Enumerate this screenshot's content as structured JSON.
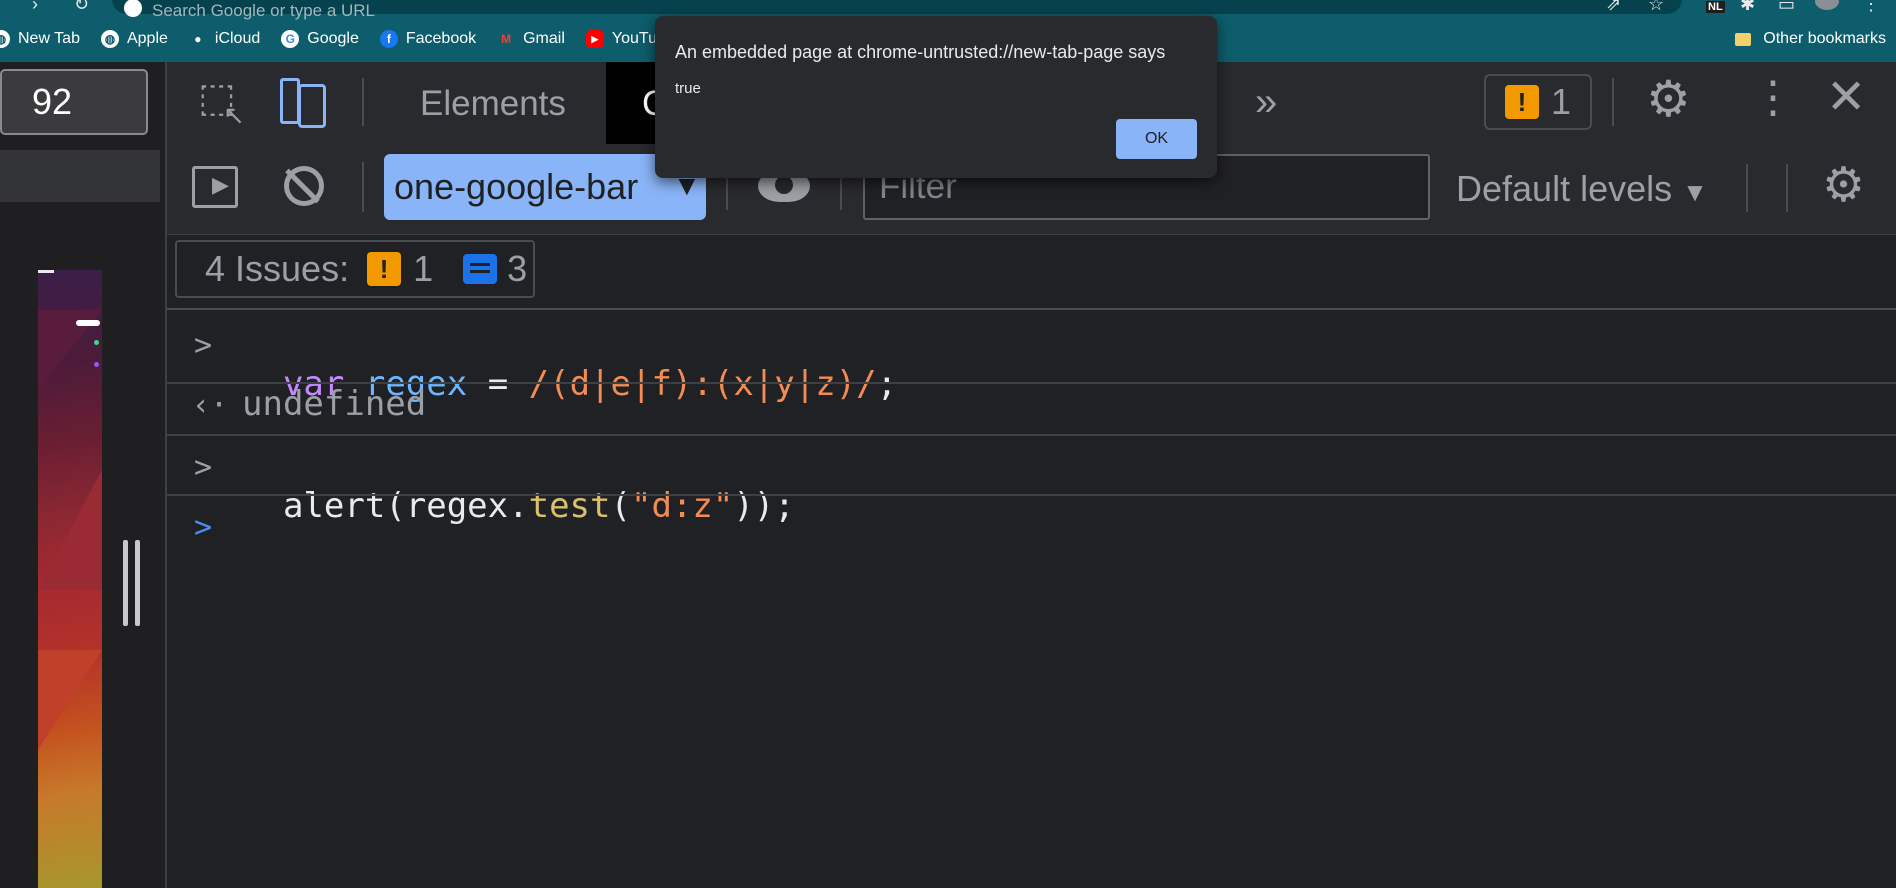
{
  "omnibox": {
    "placeholder": "Search Google or type a URL"
  },
  "bookmarks": [
    {
      "label": "New Tab",
      "icon": "globe-icon"
    },
    {
      "label": "Apple",
      "icon": "globe-icon"
    },
    {
      "label": "iCloud",
      "icon": "apple-icon"
    },
    {
      "label": "Google",
      "icon": "google-icon"
    },
    {
      "label": "Facebook",
      "icon": "facebook-icon"
    },
    {
      "label": "Gmail",
      "icon": "gmail-icon"
    },
    {
      "label": "YouTu",
      "icon": "youtube-icon"
    }
  ],
  "other_bookmarks": "Other bookmarks",
  "profile_badge": "NL",
  "devtools": {
    "zoom": "92",
    "tabs": {
      "elements": "Elements",
      "console_partial": "C"
    },
    "issues_count": "1",
    "context": "one-google-bar",
    "filter_placeholder": "Filter",
    "levels": "Default levels",
    "issues_bar": {
      "label": "4 Issues:",
      "warnings": "1",
      "infos": "3"
    }
  },
  "console": {
    "line1": {
      "kw": "var",
      "name": "regex",
      "eq": " = ",
      "regex": "/(d|e|f):(x|y|z)/",
      "semi": ";"
    },
    "line2": "undefined",
    "line3": {
      "pre": "alert(regex.",
      "method": "test",
      "open": "(",
      "str": "\"d:z\"",
      "post": "));"
    }
  },
  "dialog": {
    "message": "An embedded page at chrome-untrusted://new-tab-page says",
    "value": "true",
    "ok": "OK"
  },
  "colors": {
    "chrome_bg": "#0e5d6c",
    "devtools_bg": "#202124",
    "accent_blue": "#8ab4f8",
    "warning": "#f29900",
    "keyword": "#c58af9",
    "identifier": "#6cb6ff",
    "regex_literal": "#f28b54",
    "method": "#dbbf6b"
  }
}
